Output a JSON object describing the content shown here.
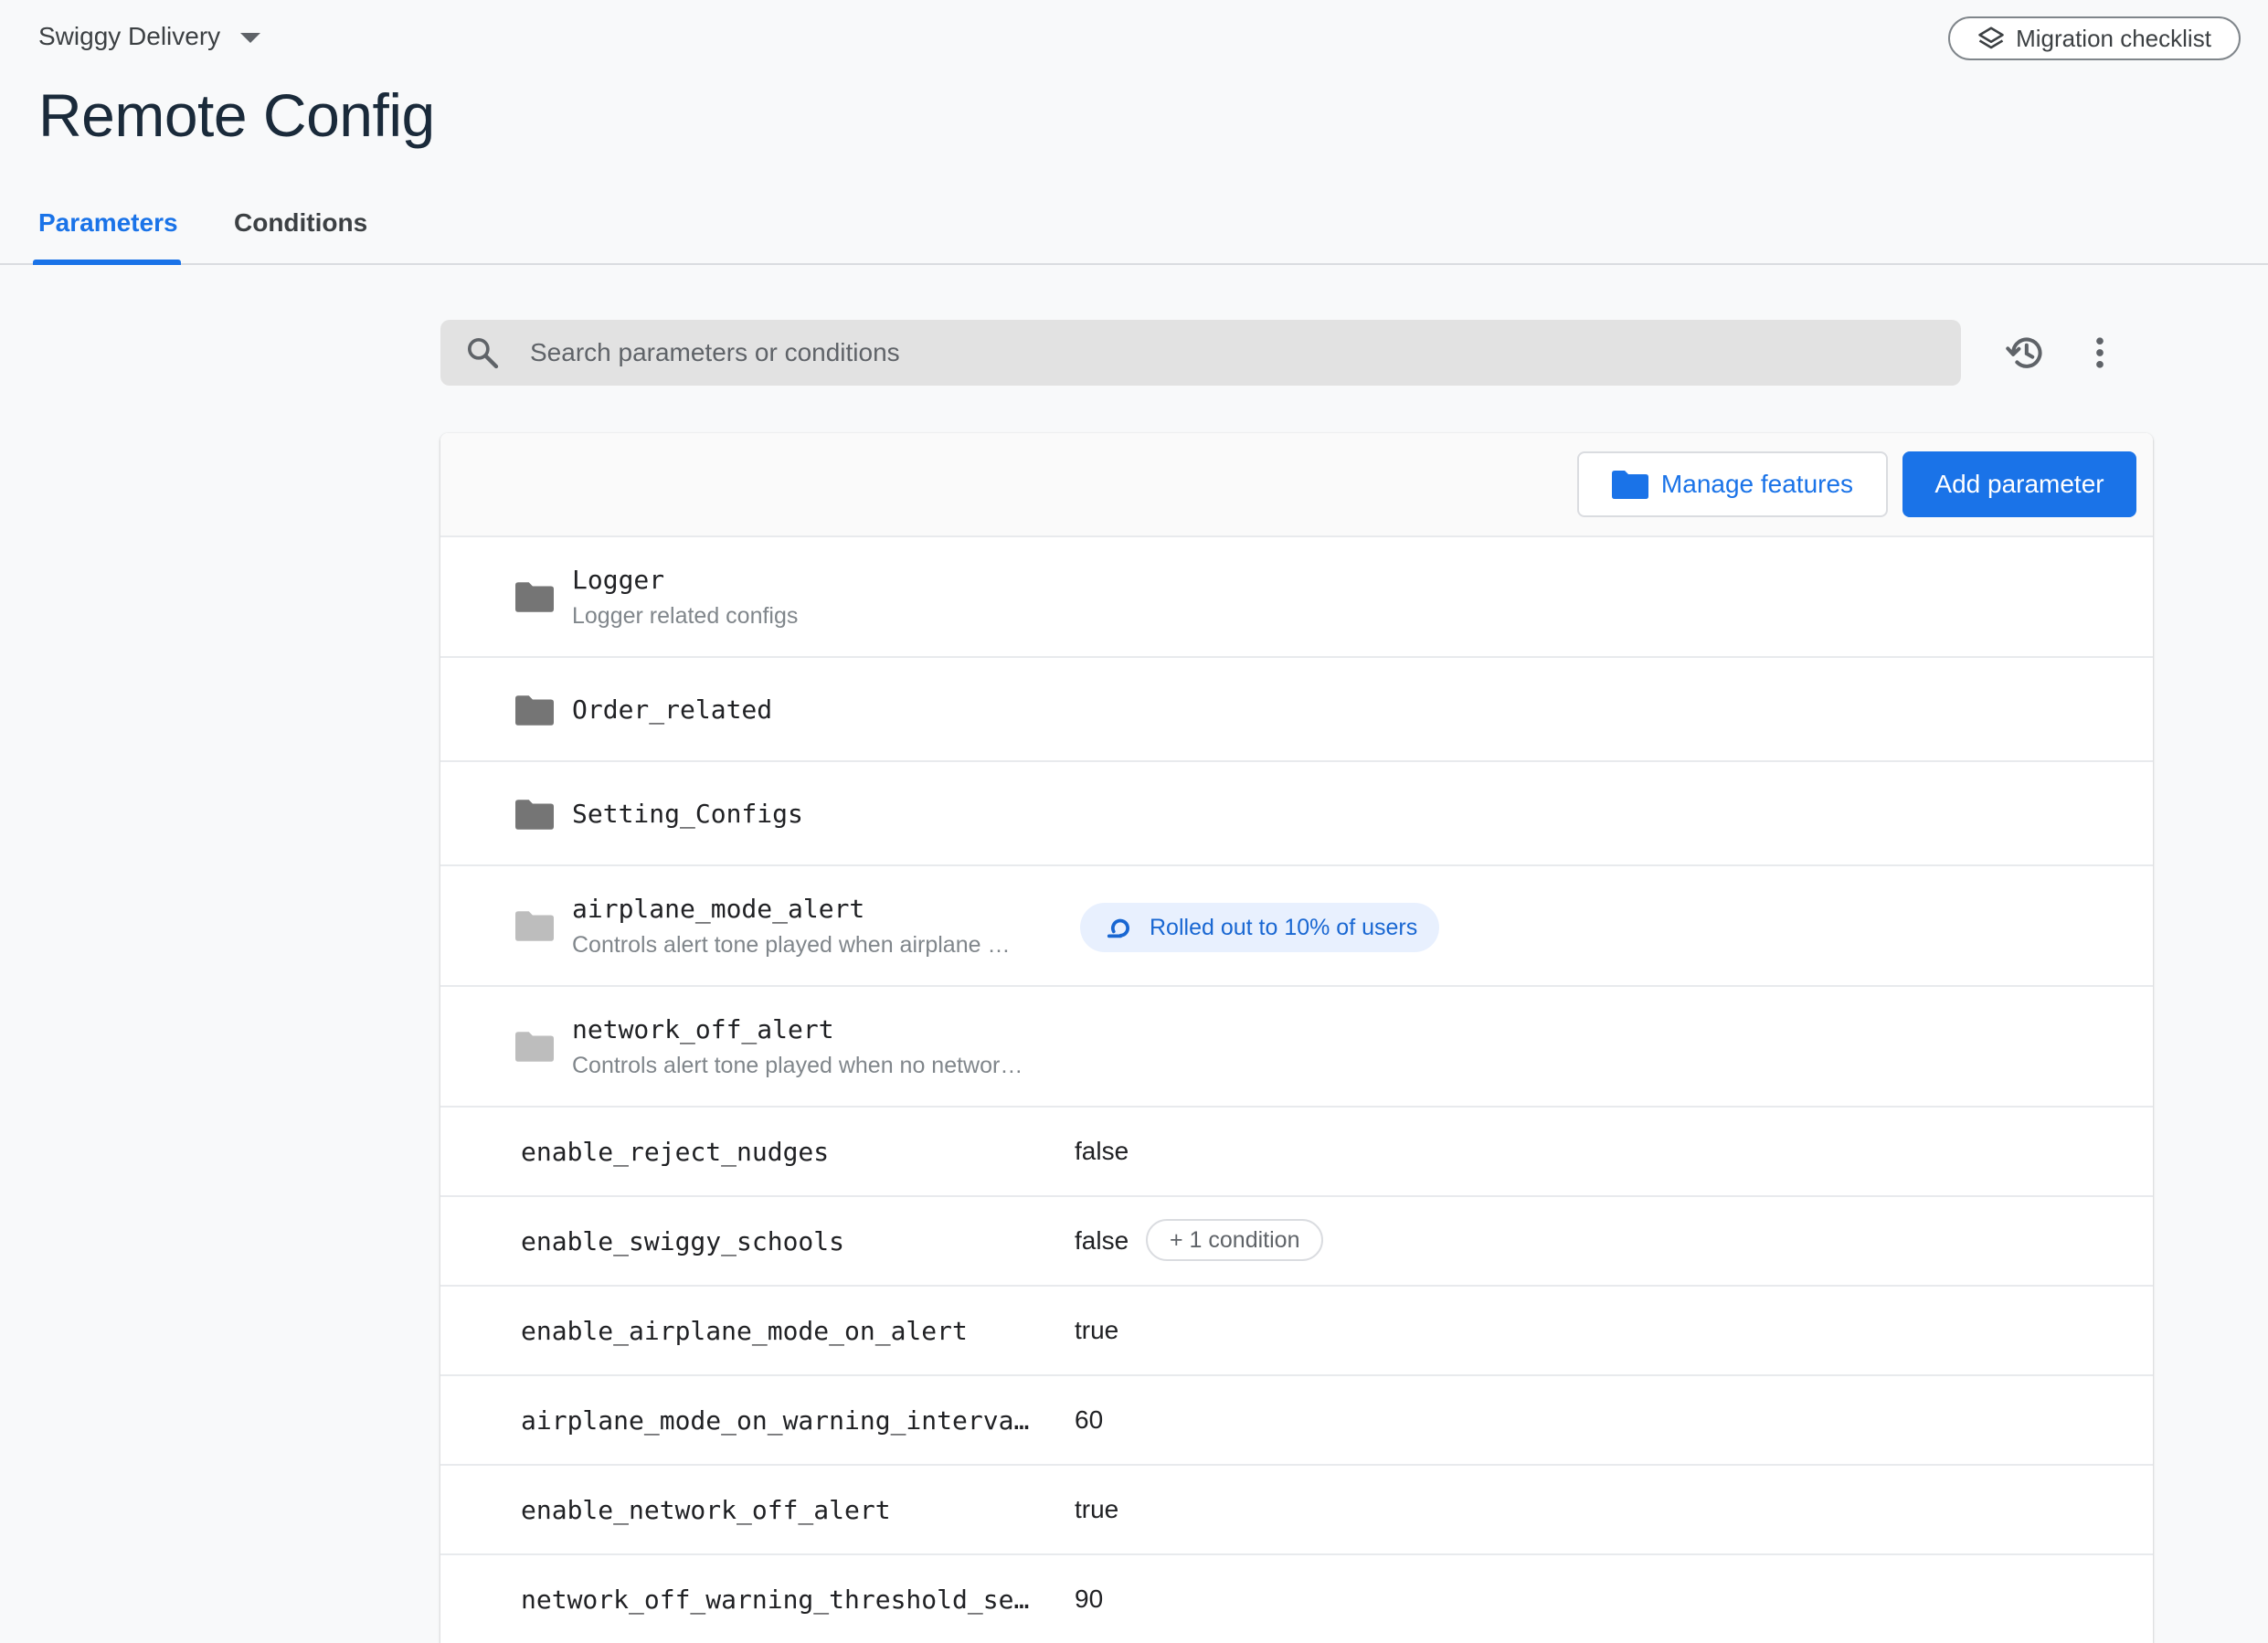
{
  "header": {
    "project_name": "Swiggy Delivery",
    "migration_label": "Migration checklist",
    "page_title": "Remote Config"
  },
  "tabs": [
    {
      "label": "Parameters",
      "active": true
    },
    {
      "label": "Conditions",
      "active": false
    }
  ],
  "search": {
    "placeholder": "Search parameters or conditions",
    "value": ""
  },
  "toolbar": {
    "manage_label": "Manage features",
    "add_label": "Add parameter"
  },
  "groups": [
    {
      "name": "Logger",
      "description": "Logger related configs",
      "badge": ""
    },
    {
      "name": "Order_related",
      "description": "",
      "badge": ""
    },
    {
      "name": "Setting_Configs",
      "description": "",
      "badge": ""
    },
    {
      "name": "airplane_mode_alert",
      "description": "Controls alert tone played when airplane …",
      "badge": "Rolled out to 10% of users"
    },
    {
      "name": "network_off_alert",
      "description": "Controls alert tone played when no networ…",
      "badge": ""
    }
  ],
  "parameters": [
    {
      "name": "enable_reject_nudges",
      "value": "false",
      "condition": ""
    },
    {
      "name": "enable_swiggy_schools",
      "value": "false",
      "condition": "+ 1 condition"
    },
    {
      "name": "enable_airplane_mode_on_alert",
      "value": "true",
      "condition": ""
    },
    {
      "name": "airplane_mode_on_warning_interva…",
      "value": "60",
      "condition": ""
    },
    {
      "name": "enable_network_off_alert",
      "value": "true",
      "condition": ""
    },
    {
      "name": "network_off_warning_threshold_se…",
      "value": "90",
      "condition": ""
    }
  ],
  "colors": {
    "accent": "#1a73e8",
    "badge_bg": "#e8f0fe",
    "folder_dark": "#757575",
    "folder_light": "#bdbdbd"
  },
  "icons": {
    "project_dropdown": "caret-down-icon",
    "migration": "layers-icon",
    "search": "search-icon",
    "history": "history-icon",
    "more": "more-vert-icon",
    "manage": "folder-icon",
    "group": "folder-icon",
    "rollout": "rollout-icon"
  }
}
